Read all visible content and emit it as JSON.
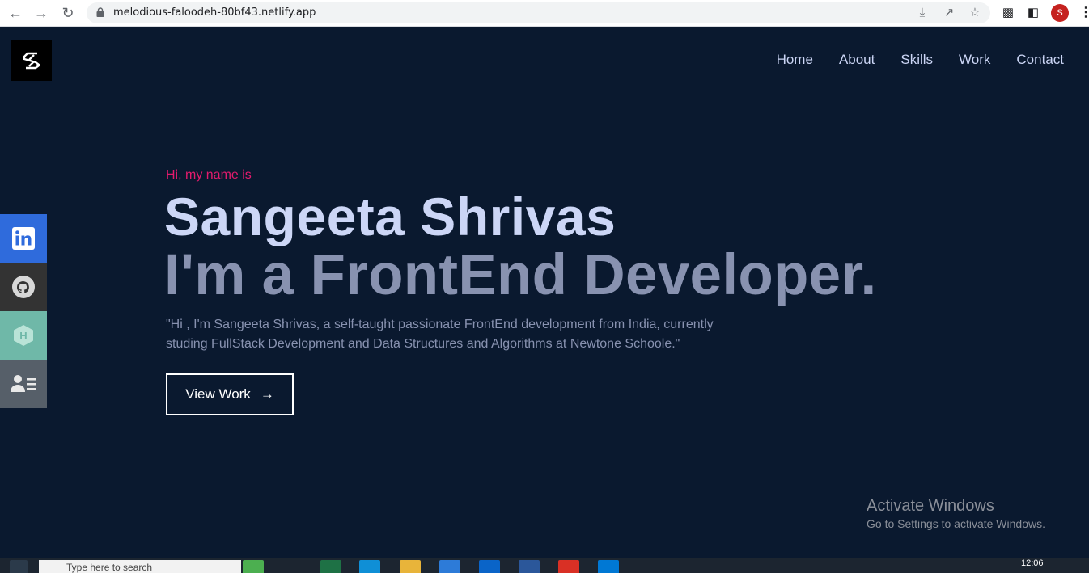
{
  "browser": {
    "url": "melodious-faloodeh-80bf43.netlify.app",
    "profile_initial": "S"
  },
  "nav": {
    "items": [
      "Home",
      "About",
      "Skills",
      "Work",
      "Contact"
    ]
  },
  "socials": {
    "items": [
      {
        "name": "linkedin-icon",
        "color": "#2f6bdc"
      },
      {
        "name": "github-icon",
        "color": "#333333"
      },
      {
        "name": "hackerrank-icon",
        "color": "#6fb8a8"
      },
      {
        "name": "resume-icon",
        "color": "#565f69"
      }
    ]
  },
  "hero": {
    "greeting": "Hi, my name is",
    "name": "Sangeeta Shrivas",
    "role": "I'm a FrontEnd Developer.",
    "bio": "\"Hi , I'm Sangeeta Shrivas, a self-taught passionate FrontEnd development from India, currently studing FullStack Development and Data Structures and Algorithms at Newtone Schoole.\"",
    "cta_label": "View Work"
  },
  "watermark": {
    "title": "Activate Windows",
    "subtitle": "Go to Settings to activate Windows."
  },
  "taskbar": {
    "search_placeholder": "Type here to search",
    "time": "12:06"
  },
  "colors": {
    "background": "#0a192f",
    "accent": "#e31b6d",
    "heading": "#ccd6f6",
    "muted": "#8892b0"
  }
}
